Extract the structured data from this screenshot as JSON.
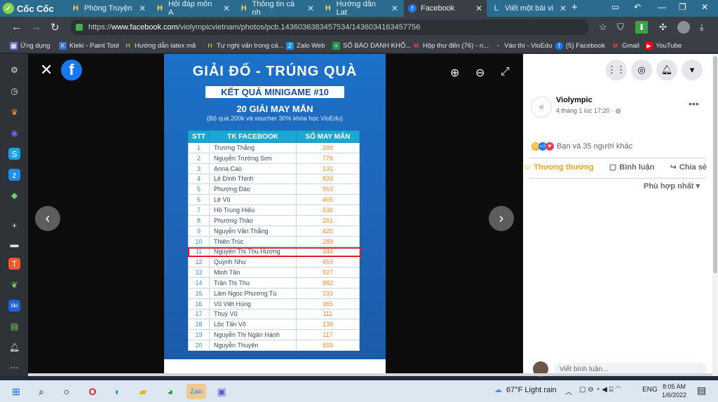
{
  "browser": {
    "brand": "Cốc Cốc",
    "tabs": [
      {
        "label": "Phòng Truyện",
        "icon": "hoidap-icon"
      },
      {
        "label": "Hỏi đáp môn A",
        "icon": "hoidap-icon"
      },
      {
        "label": "Thông tin cá nh",
        "icon": "hoidap-icon"
      },
      {
        "label": "Hướng dẫn Lat",
        "icon": "hoidap-icon"
      },
      {
        "label": "Facebook",
        "icon": "facebook-icon",
        "active": true
      },
      {
        "label": "Viết một bài vi",
        "icon": "letter-l-icon"
      }
    ],
    "url_prefix": "https://",
    "url_domain": "www.facebook.com",
    "url_path": "/violympicvietnam/photos/pcb.1436036383457534/1436034163457756",
    "bookmarks": [
      "Ứng dụng",
      "Kleki - Paint Tool",
      "Hướng dẫn latex mã",
      "Tự nghị vấn trong cá...",
      "Zalo Web",
      "SỔ BÁO DANH KHỐ...",
      "Hộp thư đến (76) - n...",
      "Vào thi - VioEdu",
      "(5) Facebook",
      "Gmail",
      "YouTube"
    ]
  },
  "photo": {
    "title": "GIẢI ĐỐ - TRÚNG QUÀ",
    "result_banner": "KẾT QUẢ MINIGAME #10",
    "subtitle": "20 GIẢI MAY MẮN",
    "note": "(Bộ quà 200k và voucher 30% khóa học VioEdu)",
    "headers": [
      "STT",
      "TK FACEBOOK",
      "SỐ MAY MẮN"
    ],
    "rows": [
      [
        "1",
        "Trương Thắng",
        "299"
      ],
      [
        "2",
        "Nguyễn Trường Sơn",
        "776"
      ],
      [
        "3",
        "Anna Cao",
        "131"
      ],
      [
        "4",
        "Lê Đình Thịnh",
        "839"
      ],
      [
        "5",
        "Phượng Đào",
        "953"
      ],
      [
        "6",
        "Lê Vũ",
        "465"
      ],
      [
        "7",
        "Hồ Trung Hiếu",
        "536"
      ],
      [
        "8",
        "Phương Thảo",
        "251"
      ],
      [
        "9",
        "Nguyễn Văn Thắng",
        "425"
      ],
      [
        "10",
        "Thiên Trúc",
        "289"
      ],
      [
        "11",
        "Nguyễn Thị Thu Hương",
        "344"
      ],
      [
        "12",
        "Quỳnh Nhu",
        "459"
      ],
      [
        "13",
        "Minh Tân",
        "927"
      ],
      [
        "14",
        "Trần Thị Thu",
        "982"
      ],
      [
        "15",
        "Lâm Ngọc Phương Tú",
        "333"
      ],
      [
        "16",
        "Vũ Việt Hùng",
        "365"
      ],
      [
        "17",
        "Thuý Vũ",
        "111"
      ],
      [
        "18",
        "Lộc Tấn Võ",
        "139"
      ],
      [
        "19",
        "Nguyễn Thị Ngân Hạnh",
        "117"
      ],
      [
        "20",
        "Nguyễn Thuyên",
        "655"
      ]
    ],
    "highlighted_row": 11
  },
  "post": {
    "page_name": "Violympic",
    "date": "4 tháng 1 lúc 17:20 · ",
    "reactions_text": "Bạn và 35 người khác",
    "actions": [
      "Thương thương",
      "Bình luận",
      "Chia sẻ"
    ],
    "sort_label": "Phù hợp nhất",
    "comment_placeholder": "Viết bình luận..."
  },
  "taskbar": {
    "weather": "67°F  Light rain",
    "language": "ENG",
    "time": "8:05 AM",
    "date": "1/6/2022"
  }
}
